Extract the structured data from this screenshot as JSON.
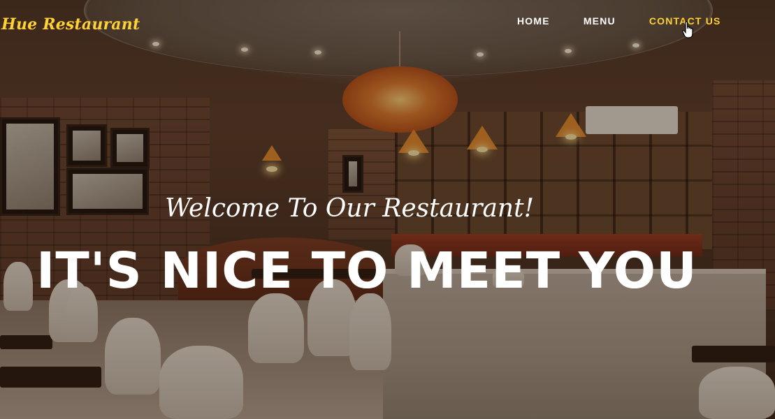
{
  "navbar": {
    "brand": "Hue Restaurant",
    "links": [
      {
        "label": "HOME"
      },
      {
        "label": "MENU"
      },
      {
        "label": "CONTACT US",
        "state": "hover"
      }
    ]
  },
  "hero": {
    "lead_in": "Welcome To Our Restaurant!",
    "heading": "IT'S NICE TO MEET YOU",
    "background": "restaurant-interior-photo"
  },
  "colors": {
    "accent": "#fed136",
    "text": "#ffffff",
    "overlay": "#3a2418"
  }
}
